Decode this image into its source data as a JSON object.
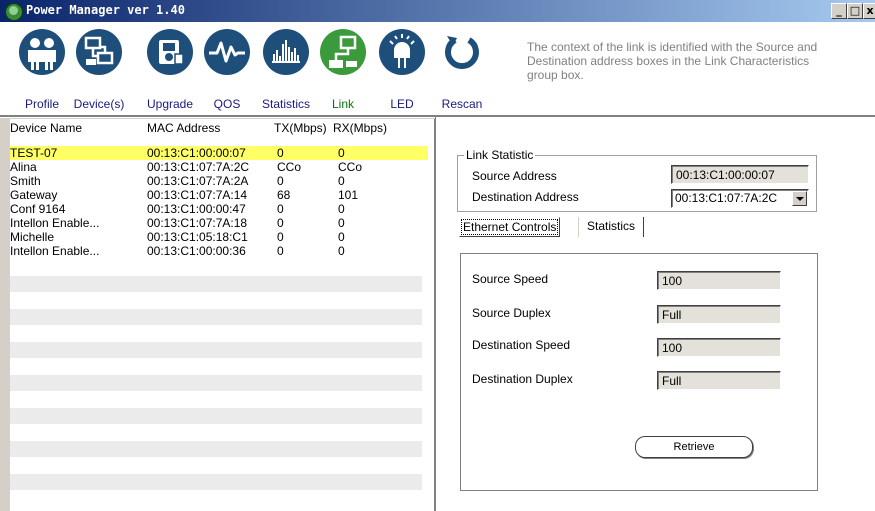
{
  "window": {
    "title": "Power Manager ver 1.40",
    "controls": {
      "minimize": "_",
      "maximize": "□",
      "close": "x"
    }
  },
  "toolbar": {
    "items": [
      {
        "label": "Profile",
        "icon": "people-icon"
      },
      {
        "label": "Device(s)",
        "icon": "network-devices-icon"
      },
      {
        "label": "Upgrade",
        "icon": "upgrade-disk-icon"
      },
      {
        "label": "QOS",
        "icon": "waveform-icon"
      },
      {
        "label": "Statistics",
        "icon": "bar-graph-icon"
      },
      {
        "label": "Link",
        "icon": "link-network-icon",
        "active": true
      },
      {
        "label": "LED",
        "icon": "led-light-icon"
      },
      {
        "label": "Rescan",
        "icon": "rescan-refresh-icon"
      }
    ],
    "hint": "The context of the link is identified with the Source and Destination address boxes in the Link Characteristics group box."
  },
  "device_table": {
    "columns": [
      "Device Name",
      "MAC Address",
      "TX(Mbps)",
      "RX(Mbps)"
    ],
    "rows": [
      {
        "name": "TEST-07",
        "mac": "00:13:C1:00:00:07",
        "tx": "0",
        "rx": "0",
        "selected": true
      },
      {
        "name": "Alina",
        "mac": "00:13:C1:07:7A:2C",
        "tx": "CCo",
        "rx": "CCo"
      },
      {
        "name": "Smith",
        "mac": "00:13:C1:07:7A:2A",
        "tx": "0",
        "rx": "0"
      },
      {
        "name": "Gateway",
        "mac": "00:13:C1:07:7A:14",
        "tx": "68",
        "rx": "101"
      },
      {
        "name": "Conf 9164",
        "mac": "00:13:C1:00:00:47",
        "tx": "0",
        "rx": "0"
      },
      {
        "name": "Intellon Enable...",
        "mac": "00:13:C1:07:7A:18",
        "tx": "0",
        "rx": "0"
      },
      {
        "name": "Michelle",
        "mac": "00:13:C1:05:18:C1",
        "tx": "0",
        "rx": "0"
      },
      {
        "name": "Intellon Enable...",
        "mac": "00:13:C1:00:00:36",
        "tx": "0",
        "rx": "0"
      }
    ]
  },
  "link_statistic": {
    "group_title": "Link Statistic",
    "source_label": "Source Address",
    "source_value": "00:13:C1:00:00:07",
    "destination_label": "Destination Address",
    "destination_value": "00:13:C1:07:7A:2C"
  },
  "tabs": [
    {
      "label": "Ethernet Controls",
      "active": true
    },
    {
      "label": "Statistics",
      "active": false
    }
  ],
  "ethernet_controls": {
    "source_speed_label": "Source Speed",
    "source_speed_value": "100",
    "source_duplex_label": "Source Duplex",
    "source_duplex_value": "Full",
    "destination_speed_label": "Destination Speed",
    "destination_speed_value": "100",
    "destination_duplex_label": "Destination Duplex",
    "destination_duplex_value": "Full",
    "retrieve_label": "Retrieve"
  },
  "colors": {
    "title_bar": "#0a246a",
    "selected_row": "#ffff66",
    "toolbar_icon": "#1e4f7a",
    "active_icon": "#3b9a3b",
    "label_blue": "#1a1a80"
  }
}
